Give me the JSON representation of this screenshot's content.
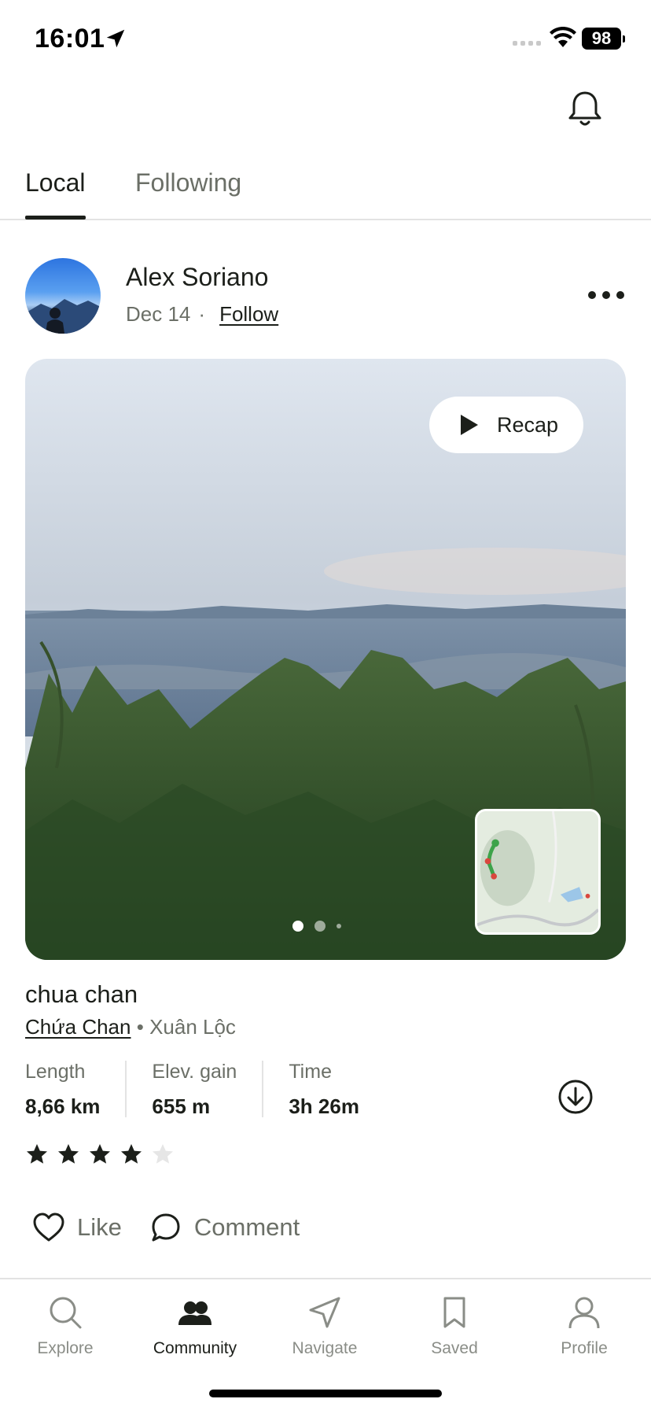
{
  "status_bar": {
    "time": "16:01",
    "battery": "98"
  },
  "tabs": [
    {
      "label": "Local",
      "active": true
    },
    {
      "label": "Following",
      "active": false
    }
  ],
  "post": {
    "user_name": "Alex Soriano",
    "date": "Dec 14",
    "separator": "·",
    "follow_label": "Follow",
    "recap_label": "Recap",
    "photo_count": 3,
    "current_photo": 1,
    "trail_title": "chua chan",
    "park": "Chứa Chan",
    "loc_separator": "•",
    "area": "Xuân Lộc",
    "stats": [
      {
        "label": "Length",
        "value": "8,66 km"
      },
      {
        "label": "Elev. gain",
        "value": "655 m"
      },
      {
        "label": "Time",
        "value": "3h 26m"
      }
    ],
    "rating": 4,
    "rating_max": 5,
    "like_label": "Like",
    "comment_label": "Comment"
  },
  "icons": {
    "bell": "bell-icon",
    "more": "more-icon",
    "play": "play-icon",
    "download": "download-icon",
    "heart": "heart-icon",
    "comment": "comment-icon"
  },
  "bottom_nav": [
    {
      "label": "Explore",
      "icon": "search-icon",
      "active": false
    },
    {
      "label": "Community",
      "icon": "community-icon",
      "active": true
    },
    {
      "label": "Navigate",
      "icon": "navigate-icon",
      "active": false
    },
    {
      "label": "Saved",
      "icon": "bookmark-icon",
      "active": false
    },
    {
      "label": "Profile",
      "icon": "profile-icon",
      "active": false
    }
  ],
  "colors": {
    "text": "#1c1f1a",
    "muted": "#6b6f67",
    "divider": "#e3e3e3",
    "star_off": "#e6e6e6"
  }
}
